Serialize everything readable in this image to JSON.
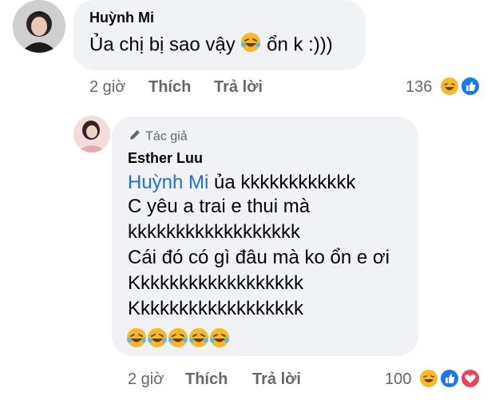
{
  "comment": {
    "author": "Huỳnh Mi",
    "text_before": "Ủa chị bị sao vậy",
    "text_after": "ổn k :)))",
    "emoji": "rolling-on-floor-laughing",
    "time": "2 giờ",
    "like_label": "Thích",
    "reply_label": "Trả lời",
    "reaction_count": "136",
    "reactions": [
      "haha",
      "like"
    ]
  },
  "reply": {
    "badge": "Tác giả",
    "author": "Esther Luu",
    "mention": "Huỳnh Mi",
    "line1_after_mention": "ủa kkkkkkkkkkkk",
    "line2": "C yêu a trai e thui mà",
    "line3": "kkkkkkkkkkkkkkkkkk",
    "line4": "Cái đó có gì đâu mà ko ổn e ơi",
    "line5": "Kkkkkkkkkkkkkkkkkk",
    "line6": "Kkkkkkkkkkkkkkkkkk",
    "emoji_count_row": "rolling-on-floor-laughing x5",
    "time": "2 giờ",
    "like_label": "Thích",
    "reply_label": "Trả lời",
    "reaction_count": "100",
    "reactions": [
      "haha",
      "like",
      "love"
    ]
  },
  "colors": {
    "bubble": "#f0f2f5",
    "meta_text": "#65676b",
    "mention": "#216fdb",
    "like_blue": "#1877f2",
    "love_red": "#f33e58",
    "haha_yellow": "#f7b928"
  }
}
